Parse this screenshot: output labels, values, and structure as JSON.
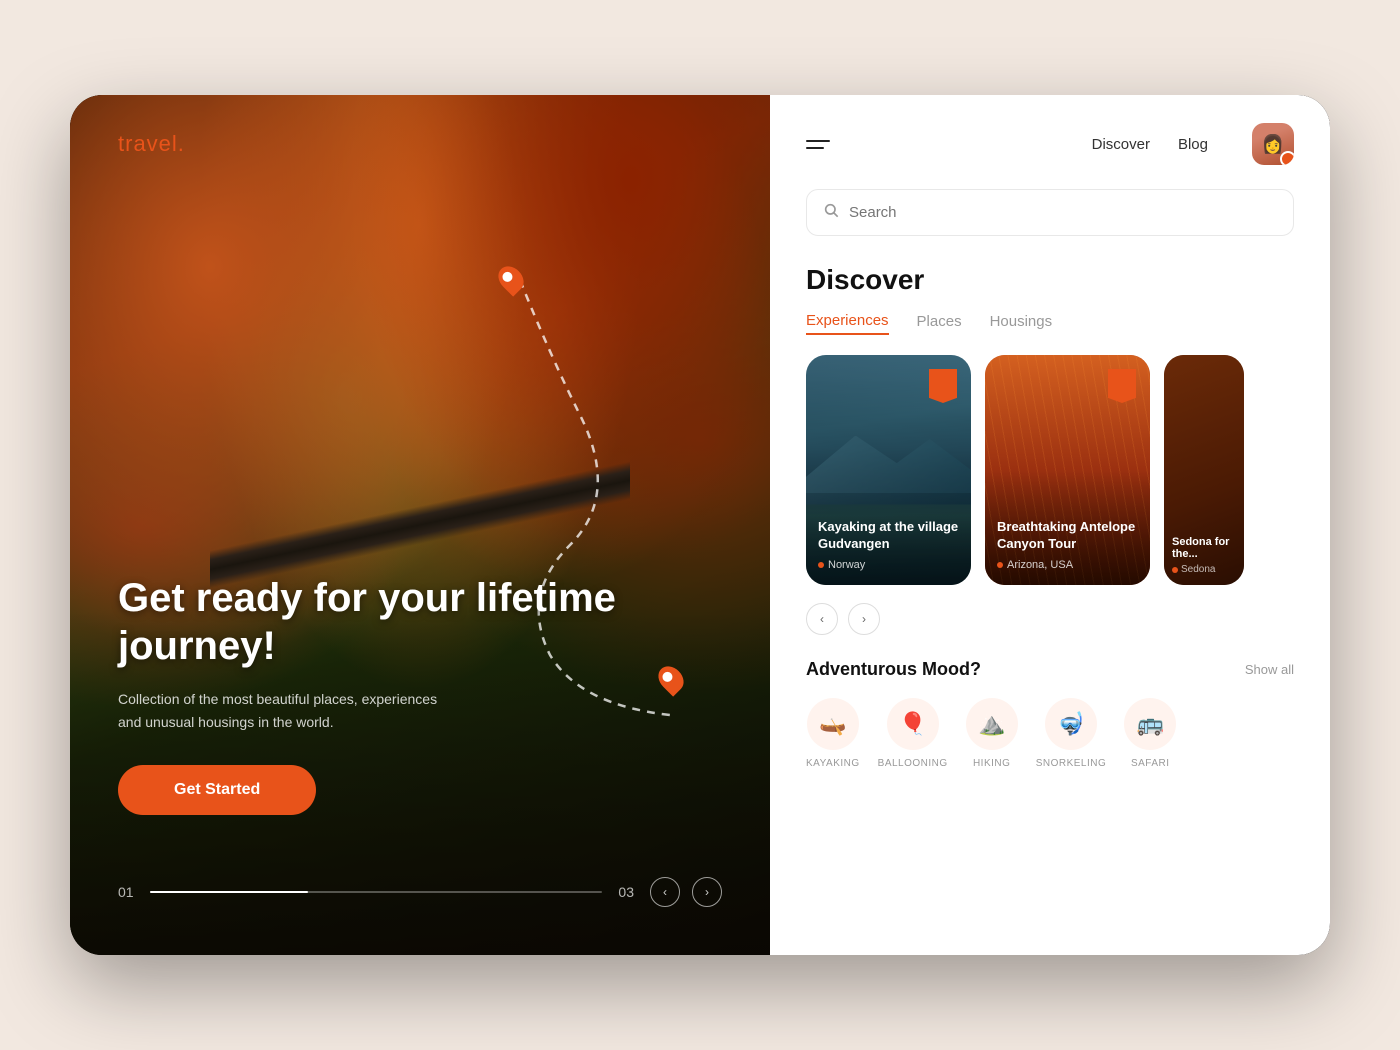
{
  "app": {
    "brand": "travel",
    "brand_dot": "."
  },
  "left": {
    "hero_title": "Get ready for your lifetime journey!",
    "hero_subtitle": "Collection of the most beautiful places, experiences and unusual housings in the world.",
    "cta_label": "Get Started",
    "slide_start": "01",
    "slide_end": "03"
  },
  "nav": {
    "discover_label": "Discover",
    "blog_label": "Blog"
  },
  "search": {
    "placeholder": "Search"
  },
  "discover": {
    "title": "Discover",
    "tabs": [
      {
        "label": "Experiences",
        "active": true
      },
      {
        "label": "Places",
        "active": false
      },
      {
        "label": "Housings",
        "active": false
      }
    ],
    "cards": [
      {
        "title": "Kayaking at the village Gudvangen",
        "location": "Norway",
        "bookmark": true
      },
      {
        "title": "Breathtaking Antelope Canyon Tour",
        "location": "Arizona, USA",
        "bookmark": true
      },
      {
        "title": "Sedona for the...",
        "location": "Sedona",
        "bookmark": false,
        "partial": true
      }
    ]
  },
  "mood": {
    "title": "Adventurous Mood?",
    "show_all": "Show all",
    "activities": [
      {
        "label": "KAYAKING",
        "icon": "🛶"
      },
      {
        "label": "BALLOONING",
        "icon": "🎈"
      },
      {
        "label": "HIKING",
        "icon": "⛰️"
      },
      {
        "label": "SNORKELING",
        "icon": "🤿"
      },
      {
        "label": "SAFARI",
        "icon": "🚌"
      }
    ]
  },
  "colors": {
    "accent": "#e8531a",
    "text_primary": "#111",
    "text_secondary": "#999",
    "white": "#ffffff"
  }
}
